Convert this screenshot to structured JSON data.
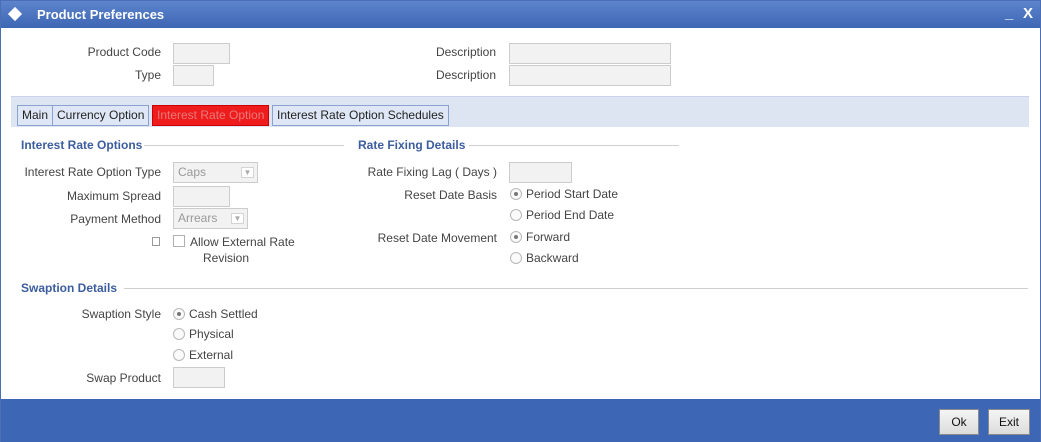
{
  "window": {
    "title": "Product Preferences",
    "minimize": "_",
    "close": "X"
  },
  "header": {
    "product_code_label": "Product Code",
    "type_label": "Type",
    "description_label_1": "Description",
    "description_label_2": "Description",
    "product_code_value": "",
    "type_value": "",
    "description_value_1": "",
    "description_value_2": ""
  },
  "tabs": [
    {
      "label": "Main"
    },
    {
      "label": "Currency Option"
    },
    {
      "label": "Interest Rate Option",
      "active": true
    },
    {
      "label": "Interest Rate Option Schedules"
    }
  ],
  "interest_rate_options": {
    "section_title": "Interest Rate Options",
    "option_type_label": "Interest Rate Option Type",
    "option_type_value": "Caps",
    "max_spread_label": "Maximum Spread",
    "max_spread_value": "",
    "payment_method_label": "Payment Method",
    "payment_method_value": "Arrears",
    "allow_external_line1": "Allow External Rate",
    "allow_external_line2": "Revision",
    "allow_external_checked": false
  },
  "rate_fixing": {
    "section_title": "Rate Fixing Details",
    "lag_label": "Rate Fixing Lag ( Days )",
    "lag_value": "",
    "reset_basis_label": "Reset Date Basis",
    "reset_basis_options": [
      "Period Start Date",
      "Period End Date"
    ],
    "reset_basis_selected": "Period Start Date",
    "reset_movement_label": "Reset Date Movement",
    "reset_movement_options": [
      "Forward",
      "Backward"
    ],
    "reset_movement_selected": "Forward"
  },
  "swaption": {
    "section_title": "Swaption Details",
    "style_label": "Swaption Style",
    "style_options": [
      "Cash Settled",
      "Physical",
      "External"
    ],
    "style_selected": "Cash Settled",
    "swap_product_label": "Swap Product",
    "swap_product_value": ""
  },
  "footer": {
    "ok_label": "Ok",
    "exit_label": "Exit"
  }
}
